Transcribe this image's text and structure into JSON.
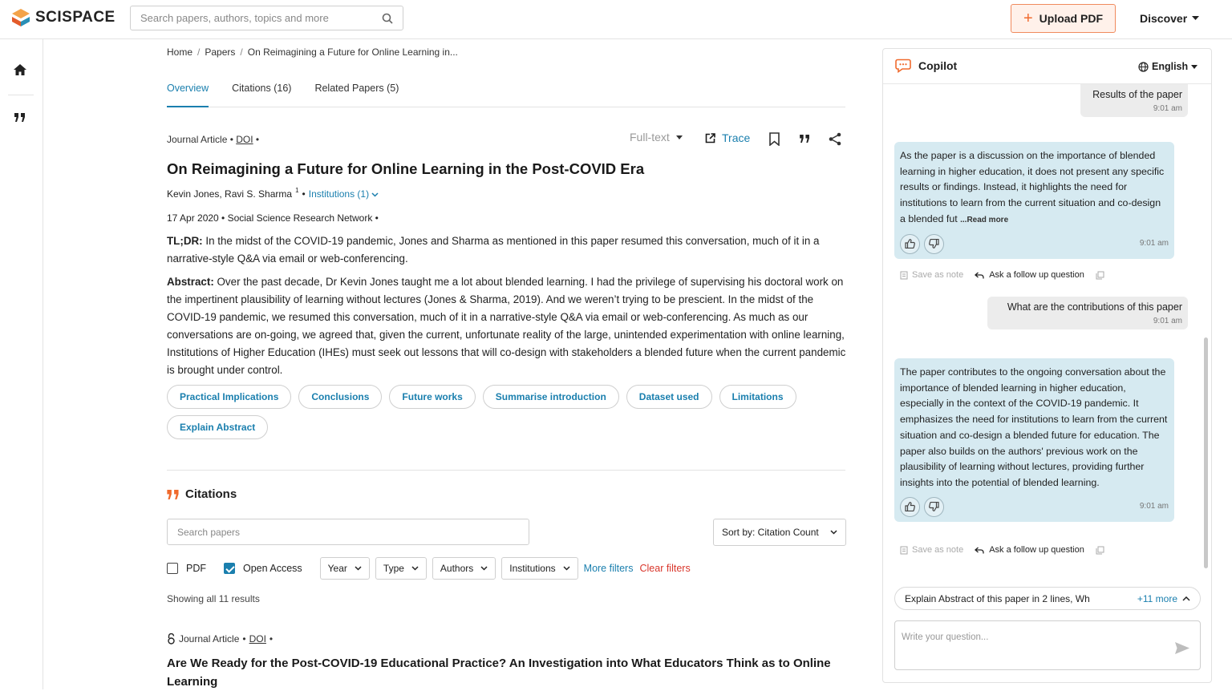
{
  "header": {
    "logo": "SCISPACE",
    "search_placeholder": "Search papers, authors, topics and more",
    "upload_label": "Upload PDF",
    "discover_label": "Discover"
  },
  "breadcrumb": [
    "Home",
    "Papers",
    "On Reimagining a Future for Online Learning in..."
  ],
  "tabs": [
    "Overview",
    "Citations (16)",
    "Related Papers (5)"
  ],
  "paper": {
    "type": "Journal Article",
    "doi": "DOI",
    "fulltext_label": "Full-text",
    "trace_label": "Trace",
    "title": "On Reimagining a Future for Online Learning in the Post-COVID Era",
    "authors": "Kevin Jones, Ravi S. Sharma",
    "author_sup": "1",
    "institutions": "Institutions (1)",
    "dateline": "17 Apr 2020 • Social Science Research Network •",
    "tldr_label": "TL;DR:",
    "tldr": "In the midst of the COVID-19 pandemic, Jones and Sharma as mentioned in this paper resumed this conversation, much of it in a narrative-style Q&A via email or web-conferencing.",
    "abstract_label": "Abstract:",
    "abstract": "Over the past decade, Dr Kevin Jones taught me a lot about blended learning. I had the privilege of supervising his doctoral work on the impertinent plausibility of learning without lectures (Jones & Sharma, 2019). And we weren’t trying to be prescient. In the midst of the COVID-19 pandemic, we resumed this conversation, much of it in a narrative-style Q&A via email or web-conferencing. As much as our conversations are on-going, we agreed that, given the current, unfortunate reality of the large, unintended experimentation with online learning, Institutions of Higher Education (IHEs) must seek out lessons that will co-design with stakeholders a blended future when the current pandemic is brought under control."
  },
  "chips": [
    "Practical Implications",
    "Conclusions",
    "Future works",
    "Summarise introduction",
    "Dataset used",
    "Limitations",
    "Explain Abstract"
  ],
  "citations": {
    "heading": "Citations",
    "search_placeholder": "Search papers",
    "sort_label": "Sort by: Citation Count",
    "filter_pdf": "PDF",
    "filter_open_access": "Open Access",
    "dropdowns": [
      "Year",
      "Type",
      "Authors",
      "Institutions"
    ],
    "more_filters": "More filters",
    "clear_filters": "Clear filters",
    "showing": "Showing all 11 results",
    "result": {
      "type": "Journal Article",
      "doi": "DOI",
      "title": "Are We Ready for the Post-COVID-19 Educational Practice? An Investigation into What Educators Think as to Online Learning"
    }
  },
  "copilot": {
    "title": "Copilot",
    "language": "English",
    "msg1": {
      "text": "Results of the paper",
      "time": "9:01 am"
    },
    "ans1": {
      "text": "As the paper is a discussion on the importance of blended learning in higher education, it does not present any specific results or findings. Instead, it highlights the need for institutions to learn from the current situation and co-design a blended fut",
      "read_more": "...Read more",
      "time": "9:01 am"
    },
    "msg2": {
      "text": "What are the contributions of this paper",
      "time": "9:01 am"
    },
    "ans2": {
      "text": "The paper contributes to the ongoing conversation about the importance of blended learning in higher education, especially in the context of the COVID-19 pandemic. It emphasizes the need for institutions to learn from the current situation and co-design a blended future for education. The paper also builds on the authors' previous work on the plausibility of learning without lectures, providing further insights into the potential of blended learning.",
      "time": "9:01 am"
    },
    "save_note": "Save as note",
    "ask_followup": "Ask a follow up question",
    "suggestion": "Explain Abstract of this paper in 2 lines, Wh",
    "suggestion_more": "+11 more",
    "input_placeholder": "Write your question..."
  },
  "colors": {
    "accent": "#1a7fae",
    "brand_orange": "#f06a2d",
    "answer_bg": "#d6eaf1"
  }
}
